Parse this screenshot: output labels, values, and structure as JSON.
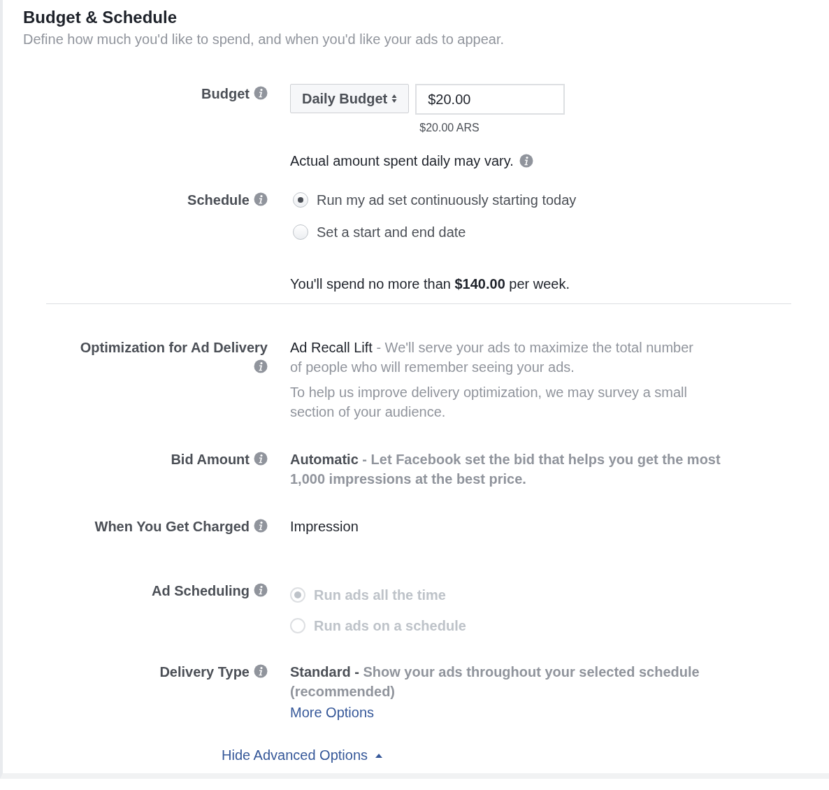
{
  "header": {
    "title": "Budget & Schedule",
    "subtitle": "Define how much you'd like to spend, and when you'd like your ads to appear."
  },
  "budget": {
    "label": "Budget",
    "select": "Daily Budget",
    "amount": "$20.00",
    "converted": "$20.00 ARS",
    "note": "Actual amount spent daily may vary."
  },
  "schedule": {
    "label": "Schedule",
    "options": [
      {
        "label": "Run my ad set continuously starting today",
        "selected": true
      },
      {
        "label": "Set a start and end date",
        "selected": false
      }
    ],
    "summary": "You'll spend no more than **$140.00** per week."
  },
  "optimization": {
    "label": "Optimization for Ad Delivery",
    "value": "Ad Recall Lift",
    "description": "- We'll serve your ads to maximize the total number of people who will remember seeing your ads.",
    "note": "To help us improve delivery optimization, we may survey a small section of your audience."
  },
  "bid": {
    "label": "Bid Amount",
    "value": "Automatic",
    "description": "- Let Facebook set the bid that helps you get the most 1,000 impressions at the best price."
  },
  "charged": {
    "label": "When You Get Charged",
    "value": "Impression"
  },
  "ad_scheduling": {
    "label": "Ad Scheduling",
    "disabled": true,
    "options": [
      {
        "label": "Run ads all the time",
        "selected": true
      },
      {
        "label": "Run ads on a schedule",
        "selected": false
      }
    ]
  },
  "delivery": {
    "label": "Delivery Type",
    "value": "Standard -",
    "description": "Show your ads throughout your selected schedule (recommended)",
    "link": "More Options"
  },
  "footer_link": "Hide Advanced Options"
}
